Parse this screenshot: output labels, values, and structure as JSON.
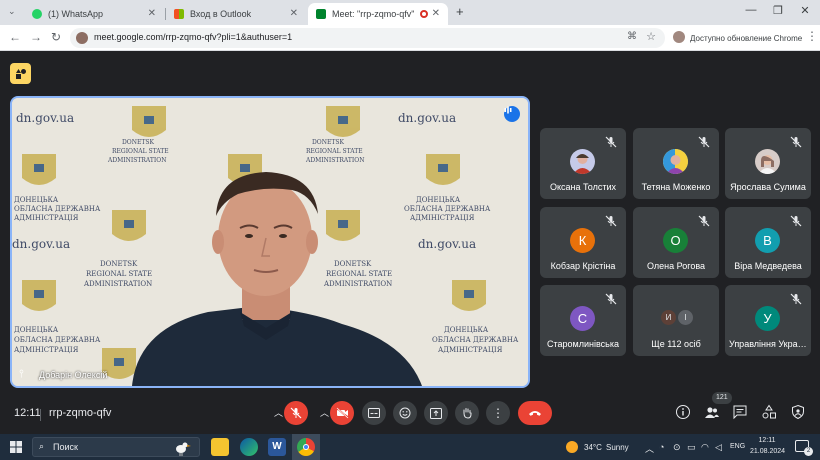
{
  "browser": {
    "tabs": [
      {
        "label": "(1) WhatsApp",
        "icon": "whatsapp-icon",
        "color": "#25d366"
      },
      {
        "label": "Вход в Outlook",
        "icon": "microsoft-icon",
        "color": "#f25022"
      },
      {
        "label": "Meet: \"rrp-zqmo-qfv\"",
        "icon": "meet-icon",
        "color": "#00832d"
      }
    ],
    "url": "meet.google.com/rrp-zqmo-qfv?pli=1&authuser=1",
    "update_label": "Доступно обновление Chrome"
  },
  "meet": {
    "main_speaker": {
      "name": "Добарін Олексій",
      "backdrop_text": {
        "domain": "dn.gov.ua",
        "en_line1": "DONETSK",
        "en_line2": "REGIONAL STATE",
        "en_line3": "ADMINISTRATION",
        "ua_line1": "ДОНЕЦЬКА",
        "ua_line2": "ОБЛАСНА ДЕРЖАВНА",
        "ua_line3": "АДМІНІСТРАЦІЯ"
      }
    },
    "participants": [
      {
        "name": "Оксана Толстих",
        "avatar": "photo",
        "color": "#c5cae9"
      },
      {
        "name": "Тетяна Моженко",
        "avatar": "photo",
        "color": "#80cbc4"
      },
      {
        "name": "Ярослава Сулима",
        "avatar": "photo",
        "color": "#d7ccc8"
      },
      {
        "name": "Кобзар Крістіна",
        "initial": "К",
        "color": "#e8710a"
      },
      {
        "name": "Олена Рогова",
        "initial": "О",
        "color": "#188038"
      },
      {
        "name": "Віра Медведева",
        "initial": "В",
        "color": "#129eaf"
      },
      {
        "name": "Старомлинівська",
        "initial": "С",
        "color": "#7e57c2"
      },
      {
        "name": "Ще 112 осіб",
        "initials": [
          "И",
          "І"
        ],
        "colors": [
          "#5d4037",
          "#5f6368"
        ]
      },
      {
        "name": "Управління Україна",
        "initial": "У",
        "color": "#00897b"
      }
    ],
    "clock": "12:11",
    "meeting_code": "rrp-zqmo-qfv",
    "people_count": "121"
  },
  "taskbar": {
    "search_placeholder": "Поиск",
    "weather_temp": "34°C",
    "weather_condition": "Sunny",
    "language": "ENG",
    "time": "12:11",
    "date": "21.08.2024",
    "notification_count": "2"
  }
}
